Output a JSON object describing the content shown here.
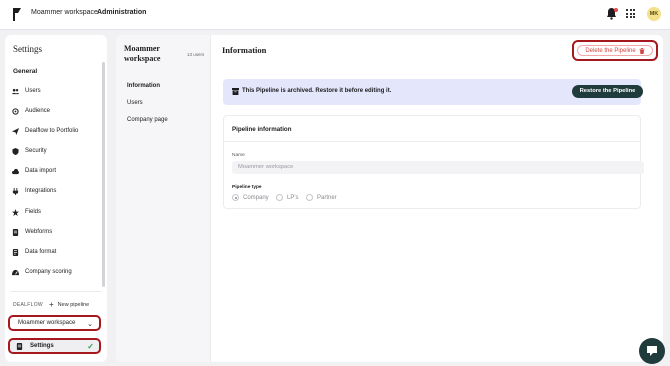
{
  "topbar": {
    "workspace": "Moammer workspace",
    "section": "Administration",
    "avatar_initials": "MK"
  },
  "sidebar": {
    "title": "Settings",
    "group": "General",
    "items": [
      {
        "label": "Users",
        "icon": "users-icon"
      },
      {
        "label": "Audience",
        "icon": "audience-icon"
      },
      {
        "label": "Dealflow to Portfolio",
        "icon": "send-icon"
      },
      {
        "label": "Security",
        "icon": "shield-icon"
      },
      {
        "label": "Data import",
        "icon": "cloud-upload-icon"
      },
      {
        "label": "Integrations",
        "icon": "plug-icon"
      },
      {
        "label": "Fields",
        "icon": "star-icon"
      },
      {
        "label": "Webforms",
        "icon": "form-icon"
      },
      {
        "label": "Data format",
        "icon": "data-format-icon"
      },
      {
        "label": "Company scoring",
        "icon": "scoring-icon"
      }
    ],
    "dealflow_label": "DEALFLOW",
    "new_pipeline": "New pipeline",
    "workspace_select": "Moammer workspace",
    "settings_button": "Settings"
  },
  "subnav": {
    "workspace_name": "Moammer workspace",
    "users_count": "13 users",
    "items": [
      "Information",
      "Users",
      "Company page"
    ]
  },
  "main": {
    "title": "Information",
    "delete_button": "Delete the Pipeline",
    "banner_text": "This Pipeline is archived. Restore it before editing it.",
    "restore_button": "Restore the Pipeline",
    "card_title": "Pipeline information",
    "name_label": "Name",
    "name_value": "Moammer workspace",
    "type_label": "Pipeline type",
    "type_options": [
      "Company",
      "LP's",
      "Partner"
    ]
  },
  "colors": {
    "accent_dark": "#1f3b3c",
    "danger": "#d54545",
    "highlight_outline": "#a5181e",
    "banner_bg": "#e4e6fb"
  }
}
